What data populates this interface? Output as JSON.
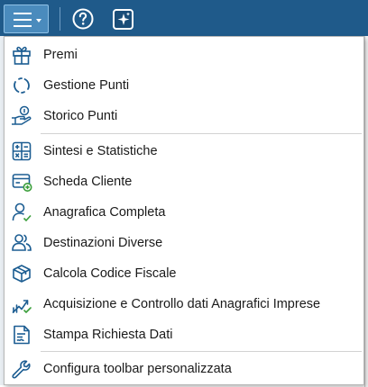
{
  "toolbar": {
    "buttons": [
      {
        "icon": "hamburger-dropdown-icon"
      },
      {
        "icon": "help-circle-icon"
      },
      {
        "icon": "sparkle-icon"
      }
    ],
    "color": "#1f5a8a",
    "active_color": "#4a8bbd"
  },
  "menu": {
    "icon_color": "#1c5d92",
    "groups": [
      {
        "items": [
          {
            "label": "Premi",
            "icon": "gift-icon"
          },
          {
            "label": "Gestione Punti",
            "icon": "refresh-circle-icon"
          },
          {
            "label": "Storico Punti",
            "icon": "hand-coin-icon"
          }
        ]
      },
      {
        "items": [
          {
            "label": "Sintesi e Statistiche",
            "icon": "calculator-icon"
          },
          {
            "label": "Scheda Cliente",
            "icon": "card-add-icon"
          },
          {
            "label": "Anagrafica Completa",
            "icon": "user-check-icon"
          },
          {
            "label": "Destinazioni Diverse",
            "icon": "users-icon"
          },
          {
            "label": "Calcola Codice Fiscale",
            "icon": "package-icon"
          },
          {
            "label": "Acquisizione e Controllo dati Anagrafici Imprese",
            "icon": "chart-check-icon"
          },
          {
            "label": "Stampa Richiesta Dati",
            "icon": "document-edit-icon"
          }
        ]
      },
      {
        "items": [
          {
            "label": "Configura toolbar personalizzata",
            "icon": "wrench-icon"
          }
        ]
      }
    ]
  }
}
